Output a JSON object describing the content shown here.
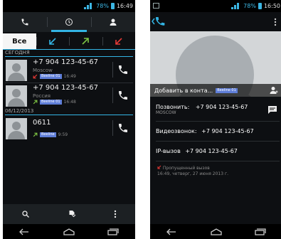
{
  "left": {
    "status": {
      "battery": "78%",
      "time": "16:49"
    },
    "filters": {
      "all_label": "Все"
    },
    "sections": {
      "today": "СЕГОДНЯ",
      "date": "06/12/2013"
    },
    "calls": [
      {
        "number": "+7 904 123-45-67",
        "location": "Moscow",
        "sim": "Beeline 01",
        "time": "16:49",
        "type": "missed"
      },
      {
        "number": "+7 904 123-45-67",
        "location": "Россия",
        "sim": "Beeline 01",
        "time": "16:48",
        "type": "outgoing"
      },
      {
        "number": "0611",
        "location": "",
        "sim": "Beeline",
        "time": "9:59",
        "type": "outgoing"
      }
    ]
  },
  "right": {
    "status": {
      "battery": "78%",
      "time": "16:50"
    },
    "add_contact_label": "Добавить в конта...",
    "add_contact_sim": "Beeline 01",
    "call_label": "Позвонить:",
    "call_number": "+7 904 123-45-67",
    "call_location": "MOSCOW",
    "video_label": "Видеозвонок:",
    "video_number": "+7 904 123-45-67",
    "ip_label": "IP-вызов",
    "ip_number": "+7 904 123-45-67",
    "missed_label": "Пропущенный вызов",
    "missed_time": "16:49, четверг, 27 июня 2013 г."
  },
  "colors": {
    "accent": "#33b5e5",
    "missed": "#e53935",
    "outgoing": "#7cc243",
    "incoming": "#33b5e5"
  }
}
